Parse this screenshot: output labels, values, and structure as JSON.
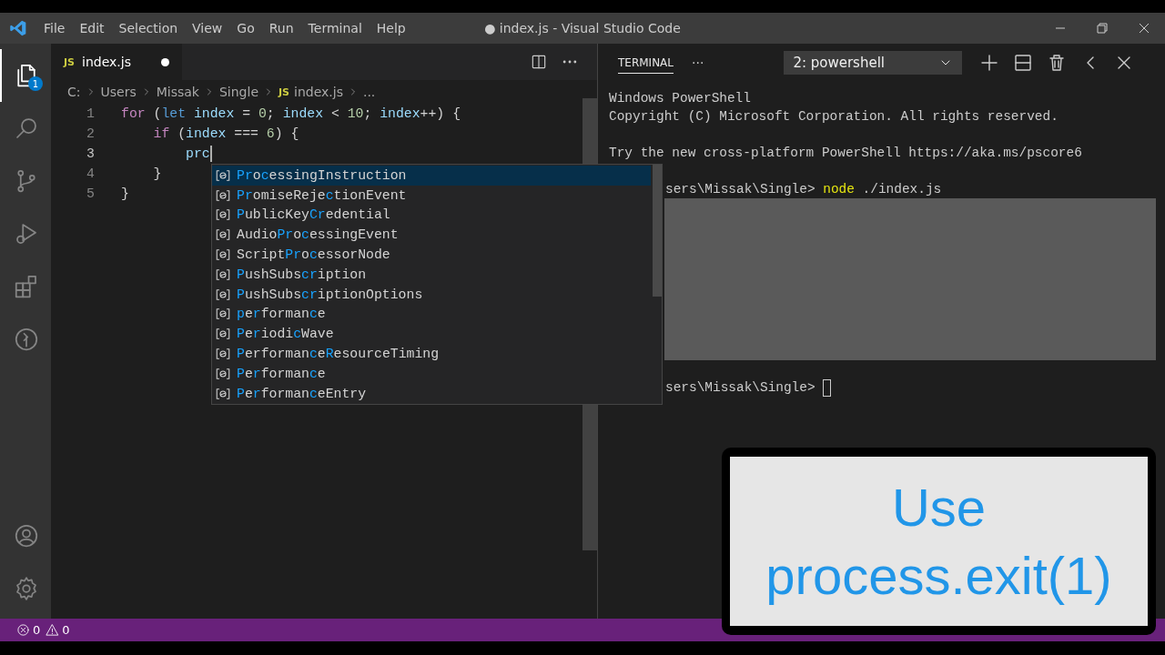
{
  "title_bar": {
    "menu": [
      "File",
      "Edit",
      "Selection",
      "View",
      "Go",
      "Run",
      "Terminal",
      "Help"
    ],
    "title": "● index.js - Visual Studio Code"
  },
  "activity_bar": {
    "items": [
      {
        "kind": "files",
        "selected": true,
        "badge": "1"
      },
      {
        "kind": "search",
        "selected": false
      },
      {
        "kind": "source-control",
        "selected": false
      },
      {
        "kind": "run",
        "selected": false
      },
      {
        "kind": "extensions",
        "selected": false
      },
      {
        "kind": "remote",
        "selected": false
      }
    ],
    "bottom": [
      {
        "kind": "account"
      },
      {
        "kind": "settings"
      }
    ]
  },
  "editor": {
    "tab": {
      "label": "index.js",
      "icon": "JS",
      "modified": true
    },
    "breadcrumbs": [
      {
        "text": "C:"
      },
      {
        "text": "Users"
      },
      {
        "text": "Missak"
      },
      {
        "text": "Single"
      },
      {
        "text": "index.js",
        "icon": "JS"
      },
      {
        "text": "..."
      }
    ],
    "lines": [
      {
        "number": "1",
        "tokens": [
          {
            "text": "for",
            "kind": "control"
          },
          {
            "text": " (",
            "kind": "punct"
          },
          {
            "text": "let",
            "kind": "keyword"
          },
          {
            "text": " index",
            "kind": "var"
          },
          {
            "text": " = ",
            "kind": "punct"
          },
          {
            "text": "0",
            "kind": "num"
          },
          {
            "text": "; ",
            "kind": "punct"
          },
          {
            "text": "index",
            "kind": "var"
          },
          {
            "text": " < ",
            "kind": "punct"
          },
          {
            "text": "10",
            "kind": "num"
          },
          {
            "text": "; ",
            "kind": "punct"
          },
          {
            "text": "index",
            "kind": "var"
          },
          {
            "text": "++) {",
            "kind": "punct"
          }
        ]
      },
      {
        "number": "2",
        "tokens": [
          {
            "text": "    if",
            "kind": "control"
          },
          {
            "text": " (",
            "kind": "punct"
          },
          {
            "text": "index",
            "kind": "var"
          },
          {
            "text": " === ",
            "kind": "punct"
          },
          {
            "text": "6",
            "kind": "num"
          },
          {
            "text": ") {",
            "kind": "punct"
          }
        ]
      },
      {
        "number": "3",
        "tokens": [
          {
            "text": "        prc",
            "kind": "var"
          }
        ],
        "cursor": true
      },
      {
        "number": "4",
        "tokens": [
          {
            "text": "    }",
            "kind": "punct"
          }
        ]
      },
      {
        "number": "5",
        "tokens": [
          {
            "text": "}",
            "kind": "punct"
          }
        ]
      }
    ],
    "suggestions": [
      {
        "selected": true,
        "parts": [
          {
            "text": "Pr",
            "match": true
          },
          {
            "text": "o",
            "match": false
          },
          {
            "text": "c",
            "match": true
          },
          {
            "text": "essingInstruction",
            "match": false
          }
        ]
      },
      {
        "selected": false,
        "parts": [
          {
            "text": "Pr",
            "match": true
          },
          {
            "text": "omiseReje",
            "match": false
          },
          {
            "text": "c",
            "match": true
          },
          {
            "text": "tionEvent",
            "match": false
          }
        ]
      },
      {
        "selected": false,
        "parts": [
          {
            "text": "P",
            "match": true
          },
          {
            "text": "ublicKey",
            "match": false
          },
          {
            "text": "Cr",
            "match": true
          },
          {
            "text": "edential",
            "match": false
          }
        ]
      },
      {
        "selected": false,
        "parts": [
          {
            "text": "Audio",
            "match": false
          },
          {
            "text": "Pr",
            "match": true
          },
          {
            "text": "o",
            "match": false
          },
          {
            "text": "c",
            "match": true
          },
          {
            "text": "essingEvent",
            "match": false
          }
        ]
      },
      {
        "selected": false,
        "parts": [
          {
            "text": "Script",
            "match": false
          },
          {
            "text": "Pr",
            "match": true
          },
          {
            "text": "o",
            "match": false
          },
          {
            "text": "c",
            "match": true
          },
          {
            "text": "essorNode",
            "match": false
          }
        ]
      },
      {
        "selected": false,
        "parts": [
          {
            "text": "P",
            "match": true
          },
          {
            "text": "ushSubs",
            "match": false
          },
          {
            "text": "cr",
            "match": true
          },
          {
            "text": "iption",
            "match": false
          }
        ]
      },
      {
        "selected": false,
        "parts": [
          {
            "text": "P",
            "match": true
          },
          {
            "text": "ushSubs",
            "match": false
          },
          {
            "text": "cr",
            "match": true
          },
          {
            "text": "iptionOptions",
            "match": false
          }
        ]
      },
      {
        "selected": false,
        "parts": [
          {
            "text": "p",
            "match": true
          },
          {
            "text": "e",
            "match": false
          },
          {
            "text": "r",
            "match": true
          },
          {
            "text": "forman",
            "match": false
          },
          {
            "text": "c",
            "match": true
          },
          {
            "text": "e",
            "match": false
          }
        ]
      },
      {
        "selected": false,
        "parts": [
          {
            "text": "P",
            "match": true
          },
          {
            "text": "e",
            "match": false
          },
          {
            "text": "r",
            "match": true
          },
          {
            "text": "iodi",
            "match": false
          },
          {
            "text": "c",
            "match": true
          },
          {
            "text": "Wave",
            "match": false
          }
        ]
      },
      {
        "selected": false,
        "parts": [
          {
            "text": "P",
            "match": true
          },
          {
            "text": "erforman",
            "match": false
          },
          {
            "text": "c",
            "match": true
          },
          {
            "text": "e",
            "match": false
          },
          {
            "text": "R",
            "match": true
          },
          {
            "text": "esourceTiming",
            "match": false
          }
        ]
      },
      {
        "selected": false,
        "parts": [
          {
            "text": "P",
            "match": true
          },
          {
            "text": "e",
            "match": false
          },
          {
            "text": "r",
            "match": true
          },
          {
            "text": "forman",
            "match": false
          },
          {
            "text": "c",
            "match": true
          },
          {
            "text": "e",
            "match": false
          }
        ]
      },
      {
        "selected": false,
        "parts": [
          {
            "text": "P",
            "match": true
          },
          {
            "text": "e",
            "match": false
          },
          {
            "text": "r",
            "match": true
          },
          {
            "text": "forman",
            "match": false
          },
          {
            "text": "c",
            "match": true
          },
          {
            "text": "eEntry",
            "match": false
          }
        ]
      }
    ]
  },
  "panel": {
    "tabs": [
      {
        "label": "TERMINAL",
        "selected": true
      }
    ],
    "more": "···",
    "terminal_select": "2: powershell",
    "lines": [
      {
        "kind": "output",
        "text": "Windows PowerShell"
      },
      {
        "kind": "output",
        "text": "Copyright (C) Microsoft Corporation. All rights reserved."
      },
      {
        "kind": "blank"
      },
      {
        "kind": "output",
        "text": "Try the new cross-platform PowerShell https://aka.ms/pscore6"
      },
      {
        "kind": "blank"
      },
      {
        "kind": "prompt",
        "text": "sers\\Missak\\Single> ",
        "command": "node",
        "args": " ./index.js"
      },
      {
        "kind": "block"
      },
      {
        "kind": "blank"
      },
      {
        "kind": "prompt",
        "text": "sers\\Missak\\Single> ",
        "cursor": true
      }
    ]
  },
  "status_bar": {
    "errors": "0",
    "warnings": "0"
  },
  "caption": {
    "text": "Use process.exit(1)"
  }
}
